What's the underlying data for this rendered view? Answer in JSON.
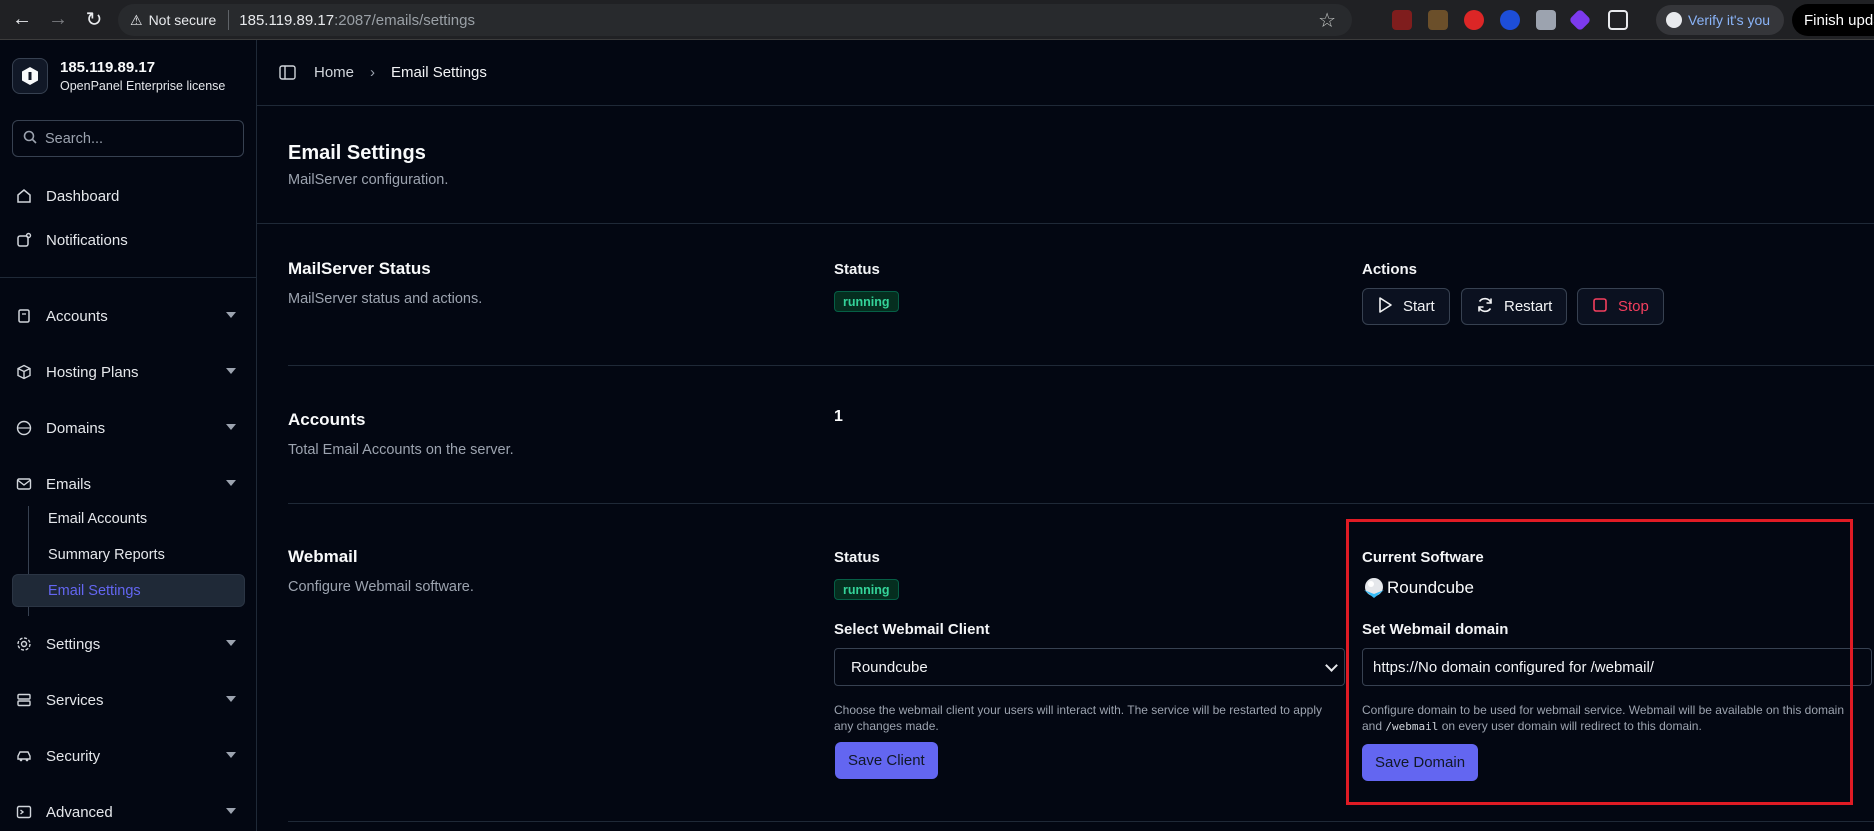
{
  "browser": {
    "security_label": "Not secure",
    "url_host": "185.119.89.17",
    "url_path": ":2087/emails/settings",
    "verify_label": "Verify it's you",
    "update_label": "Finish update"
  },
  "sidebar": {
    "server_ip": "185.119.89.17",
    "license": "OpenPanel Enterprise license",
    "search_placeholder": "Search...",
    "items": [
      {
        "label": "Dashboard"
      },
      {
        "label": "Notifications"
      },
      {
        "label": "Accounts"
      },
      {
        "label": "Hosting Plans"
      },
      {
        "label": "Domains"
      },
      {
        "label": "Emails"
      },
      {
        "label": "Settings"
      },
      {
        "label": "Services"
      },
      {
        "label": "Security"
      },
      {
        "label": "Advanced"
      }
    ],
    "email_subitems": [
      {
        "label": "Email Accounts"
      },
      {
        "label": "Summary Reports"
      },
      {
        "label": "Email Settings"
      }
    ],
    "active_color": "#6366f1"
  },
  "breadcrumb": {
    "home": "Home",
    "current": "Email Settings"
  },
  "page": {
    "title": "Email Settings",
    "subtitle": "MailServer configuration."
  },
  "mailserver": {
    "title": "MailServer Status",
    "desc": "MailServer status and actions.",
    "status_label": "Status",
    "status_value": "running",
    "actions_label": "Actions",
    "start": "Start",
    "restart": "Restart",
    "stop": "Stop"
  },
  "accounts": {
    "title": "Accounts",
    "desc": "Total Email Accounts on the server.",
    "count": "1"
  },
  "webmail": {
    "title": "Webmail",
    "desc": "Configure Webmail software.",
    "status_label": "Status",
    "status_value": "running",
    "select_label": "Select Webmail Client",
    "selected_client": "Roundcube",
    "select_help": "Choose the webmail client your users will interact with. The service will be restarted to apply any changes made.",
    "save_client": "Save Client",
    "current_label": "Current Software",
    "current_software": "Roundcube",
    "domain_label": "Set Webmail domain",
    "domain_value": "https://No domain configured for /webmail/",
    "domain_help_pre": "Configure domain to be used for webmail service. Webmail will be available on this domain and",
    "domain_help_code": "/webmail",
    "domain_help_post": "on every user domain will redirect to this domain.",
    "save_domain": "Save Domain"
  },
  "colors": {
    "accent": "#6366f1",
    "running": "#34d399",
    "stop": "#f43f5e",
    "highlight": "#e01b24"
  }
}
